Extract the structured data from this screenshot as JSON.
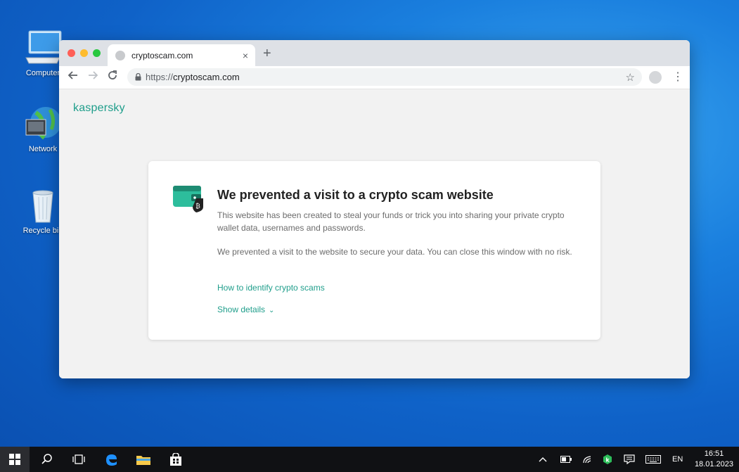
{
  "desktop": {
    "icons": [
      {
        "label": "Computer",
        "icon": "computer-icon"
      },
      {
        "label": "Network",
        "icon": "network-icon"
      },
      {
        "label": "Recycle bin",
        "icon": "recycle-bin-icon"
      }
    ]
  },
  "browser": {
    "tab": {
      "title": "cryptoscam.com",
      "close": "×"
    },
    "new_tab": "+",
    "address": {
      "scheme": "https://",
      "host": "cryptoscam.com"
    }
  },
  "page": {
    "brand": "kaspersky",
    "heading": "We prevented a visit to a crypto scam website",
    "paragraph1": "This website has been created to steal your funds or trick you into sharing your private crypto wallet data, usernames and passwords.",
    "paragraph2": "We prevented a visit to the website to secure your data. You can close this window with no risk.",
    "link_identify": "How to identify crypto scams",
    "show_details": "Show details",
    "accent_color": "#1f9e8b"
  },
  "taskbar": {
    "language": "EN",
    "time": "16:51",
    "date": "18.01.2023"
  }
}
